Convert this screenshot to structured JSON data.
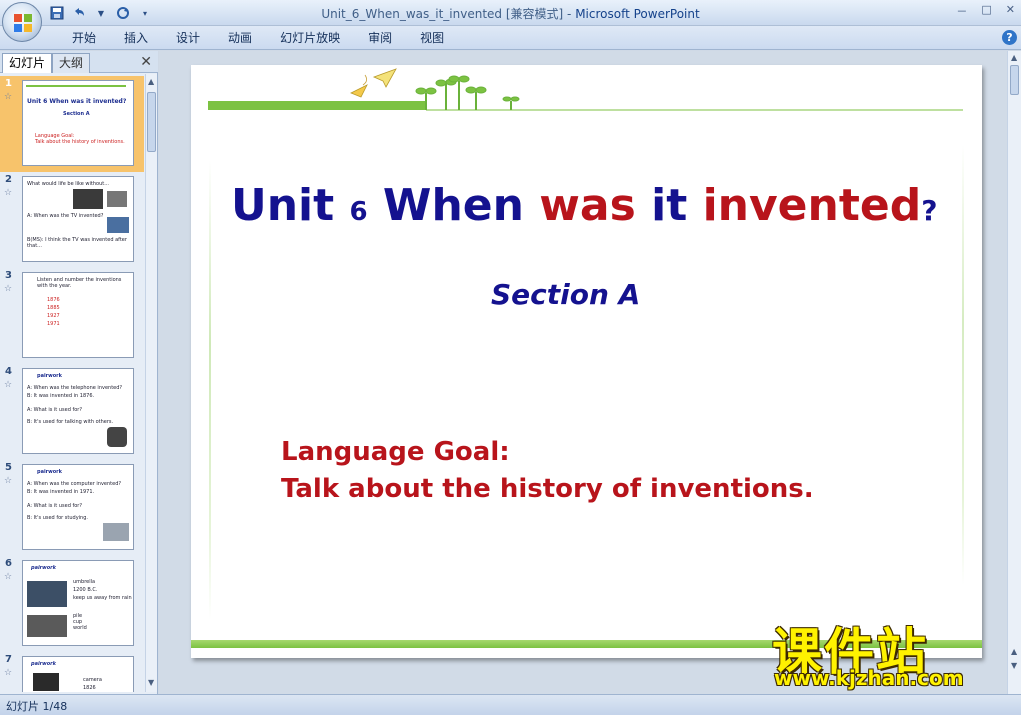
{
  "window": {
    "doc_name": "Unit_6_When_was_it_invented [兼容模式]",
    "separator": " - ",
    "app_name": "Microsoft PowerPoint",
    "controls": [
      "－",
      "□",
      "✕"
    ]
  },
  "ribbon": {
    "tabs": [
      "开始",
      "插入",
      "设计",
      "动画",
      "幻灯片放映",
      "审阅",
      "视图"
    ],
    "help": "?"
  },
  "pane": {
    "tab_slides": "幻灯片",
    "tab_outline": "大纲",
    "close": "✕"
  },
  "thumbnails": [
    {
      "num": "1",
      "lines": [
        "Unit 6 When was it invented?",
        "Section A",
        "Language Goal:",
        "Talk about the history of inventions."
      ]
    },
    {
      "num": "2",
      "lines": [
        "What would life be like without...",
        "A: When was the TV invented?",
        "B: It was invented before that...",
        "B(MS): I think the TV was invented after that..."
      ]
    },
    {
      "num": "3",
      "lines": [
        "Listen and number the inventions with the year.",
        "1876",
        "1885",
        "1927",
        "1971"
      ]
    },
    {
      "num": "4",
      "lines": [
        "pairwork",
        "A: When was the telephone invented?",
        "B: It was invented in 1876.",
        "A: What is it used for?",
        "B: It's used for talking with others."
      ]
    },
    {
      "num": "5",
      "lines": [
        "pairwork",
        "A: When was the computer invented?",
        "B: It was invented in 1971.",
        "A: What is it used for?",
        "B: It's used for studying."
      ]
    },
    {
      "num": "6",
      "lines": [
        "pairwork",
        "umbrella",
        "1200 B.C.",
        "keep us away from rain",
        "pile",
        "cup",
        "world"
      ]
    },
    {
      "num": "7",
      "lines": [
        "pairwork",
        "camera",
        "1826"
      ]
    }
  ],
  "slide": {
    "title_unit": "Unit ",
    "title_num": "6",
    "title_when": " When ",
    "title_was": "was",
    "title_it": " it ",
    "title_invented": "invented",
    "title_q": "?",
    "section": "Section A",
    "goal_label": "Language Goal:",
    "goal_text": "Talk about the history of inventions."
  },
  "watermark": {
    "big": "课件站",
    "url": "www.kjzhan.com"
  },
  "status": {
    "slide_counter": "幻灯片 1/48"
  },
  "colors": {
    "title_blue": "#14128f",
    "title_red": "#b8141b",
    "accent_green": "#7cc242",
    "selected_thumb": "#f7c36b"
  }
}
